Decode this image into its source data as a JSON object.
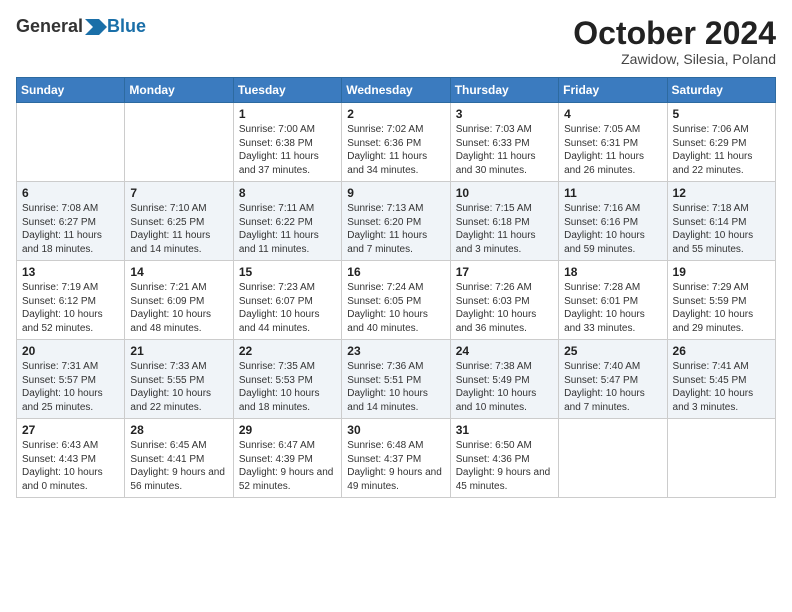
{
  "header": {
    "logo_general": "General",
    "logo_blue": "Blue",
    "month_title": "October 2024",
    "location": "Zawidow, Silesia, Poland"
  },
  "calendar": {
    "headers": [
      "Sunday",
      "Monday",
      "Tuesday",
      "Wednesday",
      "Thursday",
      "Friday",
      "Saturday"
    ],
    "rows": [
      [
        {
          "day": "",
          "info": ""
        },
        {
          "day": "",
          "info": ""
        },
        {
          "day": "1",
          "info": "Sunrise: 7:00 AM\nSunset: 6:38 PM\nDaylight: 11 hours and 37 minutes."
        },
        {
          "day": "2",
          "info": "Sunrise: 7:02 AM\nSunset: 6:36 PM\nDaylight: 11 hours and 34 minutes."
        },
        {
          "day": "3",
          "info": "Sunrise: 7:03 AM\nSunset: 6:33 PM\nDaylight: 11 hours and 30 minutes."
        },
        {
          "day": "4",
          "info": "Sunrise: 7:05 AM\nSunset: 6:31 PM\nDaylight: 11 hours and 26 minutes."
        },
        {
          "day": "5",
          "info": "Sunrise: 7:06 AM\nSunset: 6:29 PM\nDaylight: 11 hours and 22 minutes."
        }
      ],
      [
        {
          "day": "6",
          "info": "Sunrise: 7:08 AM\nSunset: 6:27 PM\nDaylight: 11 hours and 18 minutes."
        },
        {
          "day": "7",
          "info": "Sunrise: 7:10 AM\nSunset: 6:25 PM\nDaylight: 11 hours and 14 minutes."
        },
        {
          "day": "8",
          "info": "Sunrise: 7:11 AM\nSunset: 6:22 PM\nDaylight: 11 hours and 11 minutes."
        },
        {
          "day": "9",
          "info": "Sunrise: 7:13 AM\nSunset: 6:20 PM\nDaylight: 11 hours and 7 minutes."
        },
        {
          "day": "10",
          "info": "Sunrise: 7:15 AM\nSunset: 6:18 PM\nDaylight: 11 hours and 3 minutes."
        },
        {
          "day": "11",
          "info": "Sunrise: 7:16 AM\nSunset: 6:16 PM\nDaylight: 10 hours and 59 minutes."
        },
        {
          "day": "12",
          "info": "Sunrise: 7:18 AM\nSunset: 6:14 PM\nDaylight: 10 hours and 55 minutes."
        }
      ],
      [
        {
          "day": "13",
          "info": "Sunrise: 7:19 AM\nSunset: 6:12 PM\nDaylight: 10 hours and 52 minutes."
        },
        {
          "day": "14",
          "info": "Sunrise: 7:21 AM\nSunset: 6:09 PM\nDaylight: 10 hours and 48 minutes."
        },
        {
          "day": "15",
          "info": "Sunrise: 7:23 AM\nSunset: 6:07 PM\nDaylight: 10 hours and 44 minutes."
        },
        {
          "day": "16",
          "info": "Sunrise: 7:24 AM\nSunset: 6:05 PM\nDaylight: 10 hours and 40 minutes."
        },
        {
          "day": "17",
          "info": "Sunrise: 7:26 AM\nSunset: 6:03 PM\nDaylight: 10 hours and 36 minutes."
        },
        {
          "day": "18",
          "info": "Sunrise: 7:28 AM\nSunset: 6:01 PM\nDaylight: 10 hours and 33 minutes."
        },
        {
          "day": "19",
          "info": "Sunrise: 7:29 AM\nSunset: 5:59 PM\nDaylight: 10 hours and 29 minutes."
        }
      ],
      [
        {
          "day": "20",
          "info": "Sunrise: 7:31 AM\nSunset: 5:57 PM\nDaylight: 10 hours and 25 minutes."
        },
        {
          "day": "21",
          "info": "Sunrise: 7:33 AM\nSunset: 5:55 PM\nDaylight: 10 hours and 22 minutes."
        },
        {
          "day": "22",
          "info": "Sunrise: 7:35 AM\nSunset: 5:53 PM\nDaylight: 10 hours and 18 minutes."
        },
        {
          "day": "23",
          "info": "Sunrise: 7:36 AM\nSunset: 5:51 PM\nDaylight: 10 hours and 14 minutes."
        },
        {
          "day": "24",
          "info": "Sunrise: 7:38 AM\nSunset: 5:49 PM\nDaylight: 10 hours and 10 minutes."
        },
        {
          "day": "25",
          "info": "Sunrise: 7:40 AM\nSunset: 5:47 PM\nDaylight: 10 hours and 7 minutes."
        },
        {
          "day": "26",
          "info": "Sunrise: 7:41 AM\nSunset: 5:45 PM\nDaylight: 10 hours and 3 minutes."
        }
      ],
      [
        {
          "day": "27",
          "info": "Sunrise: 6:43 AM\nSunset: 4:43 PM\nDaylight: 10 hours and 0 minutes."
        },
        {
          "day": "28",
          "info": "Sunrise: 6:45 AM\nSunset: 4:41 PM\nDaylight: 9 hours and 56 minutes."
        },
        {
          "day": "29",
          "info": "Sunrise: 6:47 AM\nSunset: 4:39 PM\nDaylight: 9 hours and 52 minutes."
        },
        {
          "day": "30",
          "info": "Sunrise: 6:48 AM\nSunset: 4:37 PM\nDaylight: 9 hours and 49 minutes."
        },
        {
          "day": "31",
          "info": "Sunrise: 6:50 AM\nSunset: 4:36 PM\nDaylight: 9 hours and 45 minutes."
        },
        {
          "day": "",
          "info": ""
        },
        {
          "day": "",
          "info": ""
        }
      ]
    ]
  }
}
